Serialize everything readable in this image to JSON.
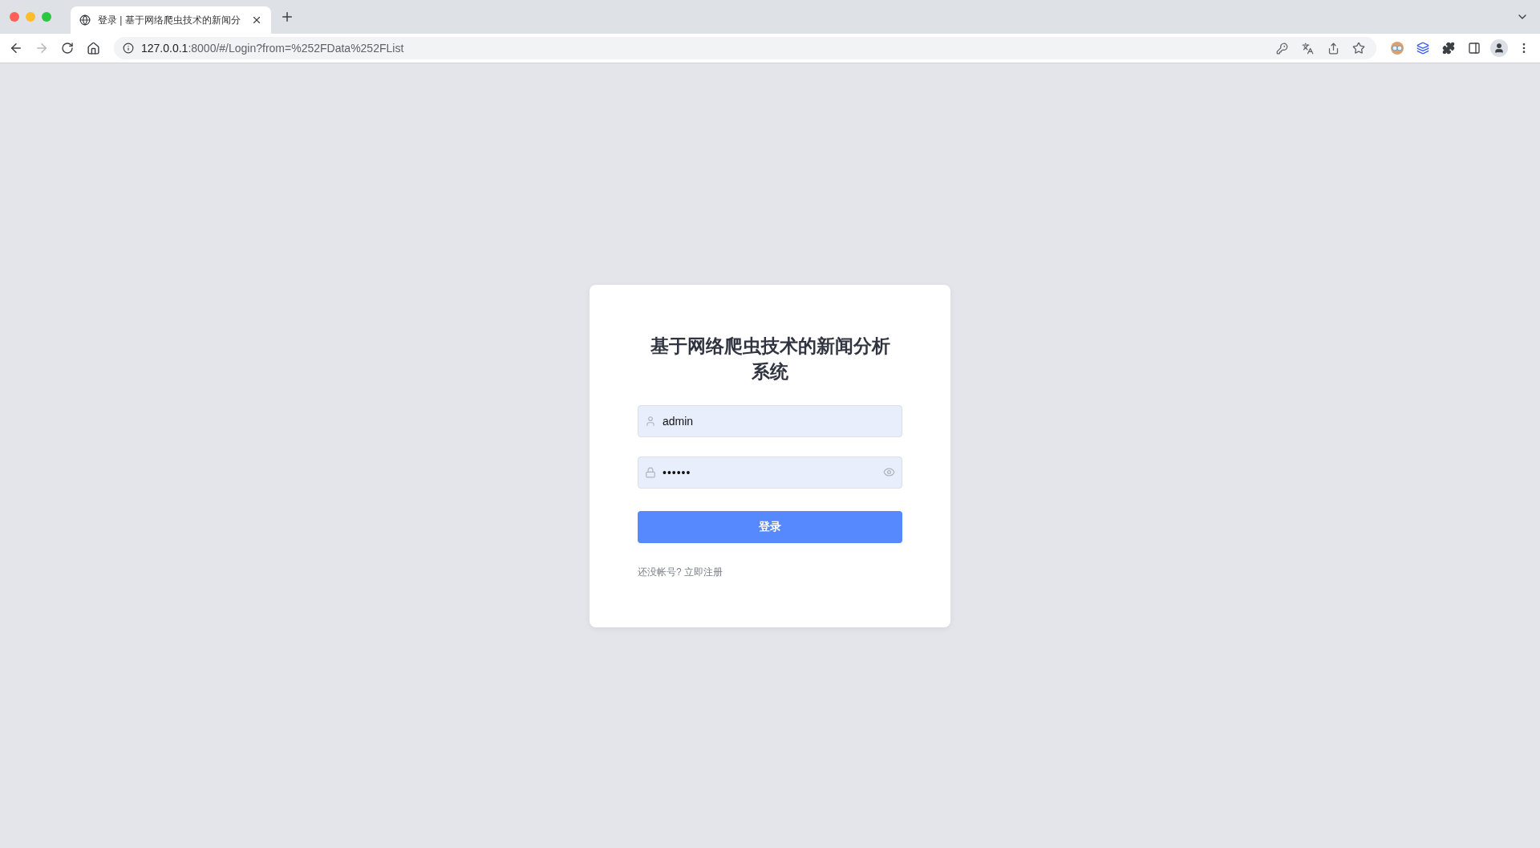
{
  "browser": {
    "tabs": [
      {
        "title": "登录 | 基于网络爬虫技术的新闻分",
        "selected": true
      }
    ],
    "forward_disabled": true,
    "url": {
      "host": "127.0.0.1",
      "path": ":8000/#/Login?from=%252FData%252FList"
    },
    "bookmarked": false
  },
  "login": {
    "title": "基于网络爬虫技术的新闻分析系统",
    "fields": [
      {
        "kind": "text",
        "value": "admin"
      },
      {
        "kind": "password",
        "value": "••••••"
      }
    ],
    "submit": "登录",
    "register_link": "还没帐号? 立即注册"
  }
}
